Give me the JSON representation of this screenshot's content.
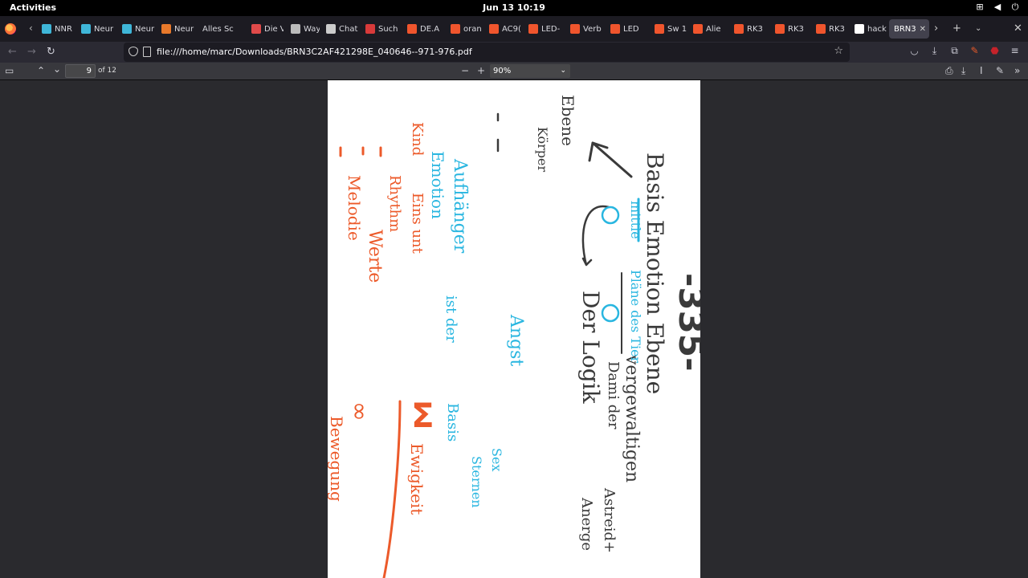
{
  "system": {
    "activities_label": "Activities",
    "clock": "Jun 13  10:19",
    "tray_icons": [
      "network-icon",
      "volume-icon",
      "power-icon"
    ]
  },
  "browser": {
    "tabs": [
      {
        "label": "NNR",
        "fav_color": "#3fb6d8"
      },
      {
        "label": "Neur",
        "fav_color": "#3fb6d8"
      },
      {
        "label": "Neur",
        "fav_color": "#3fb6d8"
      },
      {
        "label": "Neur",
        "fav_color": "#e8792b"
      },
      {
        "label": "Alles Sc",
        "fav_color": ""
      },
      {
        "label": "Die V",
        "fav_color": "#e04a4a"
      },
      {
        "label": "Way",
        "fav_color": "#bbbbbb"
      },
      {
        "label": "Chat",
        "fav_color": "#cccccc"
      },
      {
        "label": "Such",
        "fav_color": "#d83a3a"
      },
      {
        "label": "DE.A",
        "fav_color": "#f0552d"
      },
      {
        "label": "oran",
        "fav_color": "#f0552d"
      },
      {
        "label": "AC9(",
        "fav_color": "#f0552d"
      },
      {
        "label": "LED-",
        "fav_color": "#f0552d"
      },
      {
        "label": "Verb",
        "fav_color": "#f0552d"
      },
      {
        "label": "LED",
        "fav_color": "#f0552d"
      },
      {
        "label": "Sw 1",
        "fav_color": "#f0552d"
      },
      {
        "label": "Alie",
        "fav_color": "#f0552d"
      },
      {
        "label": "RK3",
        "fav_color": "#f0552d"
      },
      {
        "label": "RK3",
        "fav_color": "#f0552d"
      },
      {
        "label": "RK3",
        "fav_color": "#f0552d"
      },
      {
        "label": "hack",
        "fav_color": "#ffffff"
      },
      {
        "label": "BRN3",
        "fav_color": ""
      }
    ],
    "url": "file:///home/marc/Downloads/BRN3C2AF421298E_040646--971-976.pdf"
  },
  "pdf": {
    "page_current": "9",
    "page_of": "of 12",
    "zoom": "90%"
  },
  "handwriting": {
    "black": [
      "Basis Emotion Ebene",
      "-335-",
      "Ebene",
      "Körper",
      "Der Logik",
      "vergewaltigen",
      "Dami der",
      "Astreid+",
      "Anerge"
    ],
    "cyan": [
      "mittle",
      "Pläne des Tier",
      "Aufhänger",
      "Emotion",
      "ist der",
      "Angst",
      "Basis",
      "Sternen",
      "Sex"
    ],
    "orange": [
      "Kind",
      "Eins unt",
      "Rhythm",
      "Werte",
      "Melodie",
      "Bewegung",
      "Σ",
      "Ewigkeit",
      "∞"
    ]
  },
  "colors": {
    "ink_black": "#3a3a3a",
    "ink_cyan": "#29b6e0",
    "ink_orange": "#ec5a2a"
  }
}
